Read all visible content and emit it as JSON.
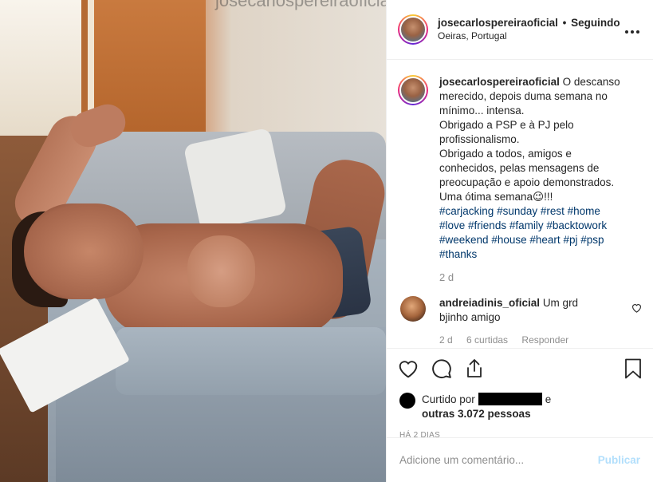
{
  "post": {
    "watermark": "josecarlospereiraoficial",
    "header": {
      "username": "josecarlospereiraoficial",
      "separator": "•",
      "follow_status": "Seguindo",
      "location": "Oeiras, Portugal",
      "more_icon": "ellipsis-icon"
    },
    "caption": {
      "username": "josecarlospereiraoficial",
      "lines": [
        "O descanso merecido, depois duma semana no mínimo... intensa.",
        "Obrigado a PSP e à PJ pelo profissionalismo.",
        "Obrigado a todos, amigos e conhecidos, pelas mensagens de preocupação e apoio demonstrados.",
        "Uma ótima semana😉!!!"
      ],
      "hashtags": [
        "#carjacking",
        "#sunday",
        "#rest",
        "#home",
        "#love",
        "#friends",
        "#family",
        "#backtowork",
        "#weekend",
        "#house",
        "#heart",
        "#pj",
        "#psp",
        "#thanks"
      ],
      "age": "2 d"
    },
    "comment": {
      "username": "andreiadinis_oficial",
      "text": "Um grd bjinho amigo",
      "age": "2 d",
      "likes": "6 curtidas",
      "reply": "Responder"
    },
    "likes": {
      "prefix": "Curtido por",
      "conjunction": "e",
      "others": "outras 3.072 pessoas"
    },
    "date": "HÁ 2 DIAS",
    "add_comment": {
      "placeholder": "Adicione um comentário...",
      "post_label": "Publicar"
    },
    "colors": {
      "link": "#00376b",
      "muted": "#8e8e8e",
      "publish_disabled": "#b2dffc"
    }
  }
}
